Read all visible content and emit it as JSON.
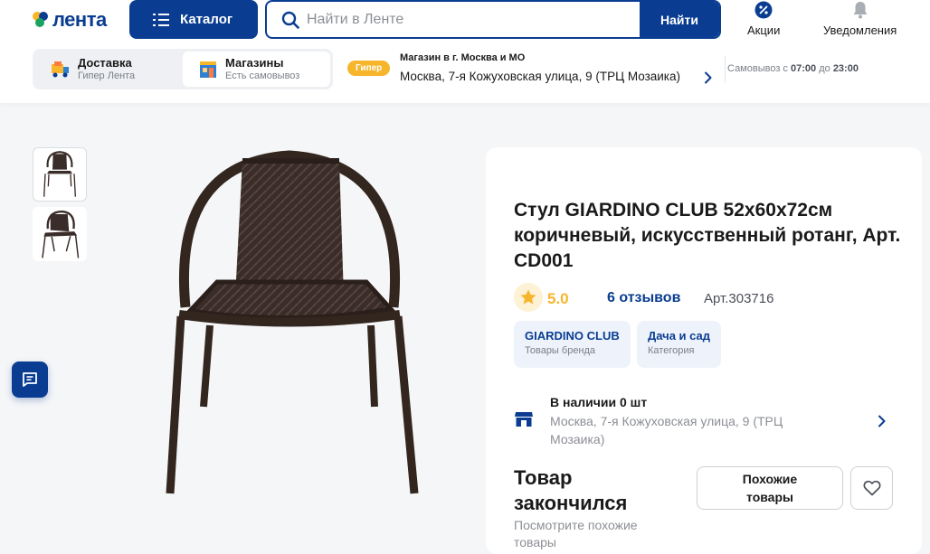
{
  "header": {
    "logo_text": "лента",
    "catalog_label": "Каталог",
    "search_placeholder": "Найти в Ленте",
    "search_button": "Найти",
    "promos_label": "Акции",
    "notifications_label": "Уведомления"
  },
  "delivery": {
    "tabs": [
      {
        "title": "Доставка",
        "subtitle": "Гипер Лента",
        "active": false
      },
      {
        "title": "Магазины",
        "subtitle": "Есть самовывоз",
        "active": true
      }
    ]
  },
  "store": {
    "badge": "Гипер",
    "title": "Магазин в г. Москва и МО",
    "address": "Москва, 7-я Кожуховская улица, 9 (ТРЦ Мозаика)",
    "pickup_prefix": "Самовывоз с",
    "pickup_from": "07:00",
    "pickup_mid": "до",
    "pickup_to": "23:00"
  },
  "product": {
    "title": "Стул GIARDINO CLUB 52x60x72см коричневый, искусственный ротанг, Арт. CD001",
    "rating": "5.0",
    "reviews": "6 отзывов",
    "article": "Арт.303716",
    "chips": [
      {
        "title": "GIARDINO CLUB",
        "subtitle": "Товары бренда"
      },
      {
        "title": "Дача и сад",
        "subtitle": "Категория"
      }
    ],
    "availability_title": "В наличии 0 шт",
    "availability_address": "Москва, 7-я Кожуховская улица, 9 (ТРЦ Мозаика)",
    "out_of_stock_title": "Товар закончился",
    "out_of_stock_sub": "Посмотрите похожие товары",
    "similar_button": "Похожие товары"
  },
  "colors": {
    "brand_blue": "#0a3d91",
    "accent_yellow": "#f7b52c",
    "chair_brown": "#3a2c28"
  }
}
